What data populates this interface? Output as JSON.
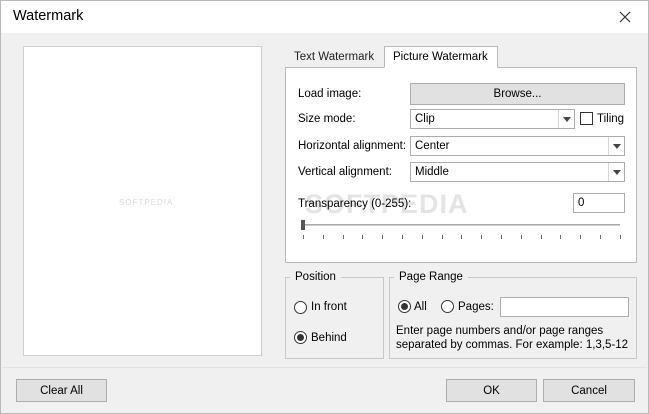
{
  "window": {
    "title": "Watermark"
  },
  "preview": {
    "watermark_text": "SOFTPEDIA"
  },
  "tabs": [
    {
      "label": "Text Watermark",
      "active": false
    },
    {
      "label": "Picture Watermark",
      "active": true
    }
  ],
  "picture": {
    "load_image_label": "Load image:",
    "browse_label": "Browse...",
    "size_mode_label": "Size mode:",
    "size_mode_value": "Clip",
    "tiling_label": "Tiling",
    "tiling_checked": false,
    "halign_label": "Horizontal alignment:",
    "halign_value": "Center",
    "valign_label": "Vertical alignment:",
    "valign_value": "Middle",
    "transparency_label": "Transparency (0-255):",
    "transparency_value": "0",
    "background_watermark": "SOFTPEDIA"
  },
  "position": {
    "legend": "Position",
    "options": [
      {
        "label": "In front",
        "selected": false
      },
      {
        "label": "Behind",
        "selected": true
      }
    ]
  },
  "page_range": {
    "legend": "Page Range",
    "all_label": "All",
    "all_selected": true,
    "pages_label": "Pages:",
    "pages_value": "",
    "hint_line1": "Enter page numbers and/or page ranges",
    "hint_line2": "separated by commas. For example: 1,3,5-12"
  },
  "footer": {
    "clear_all_label": "Clear All",
    "ok_label": "OK",
    "cancel_label": "Cancel"
  },
  "icons": {
    "close": "close-icon",
    "dropdown": "chevron-down-icon"
  }
}
